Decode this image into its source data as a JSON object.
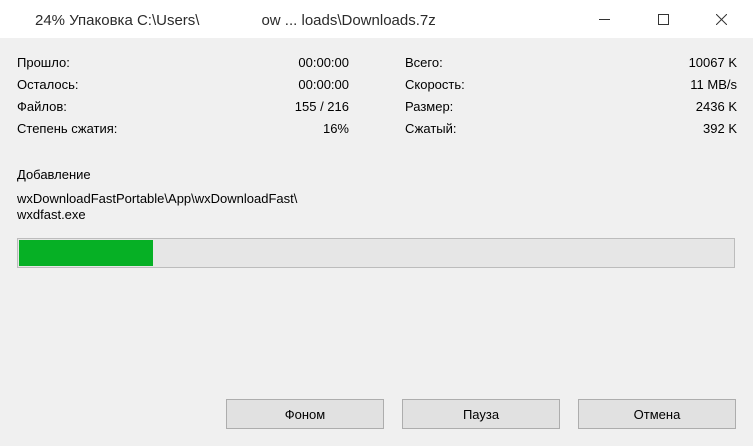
{
  "window": {
    "title_left": "24% Упаковка C:\\Users\\",
    "title_right": "ow ... loads\\Downloads.7z"
  },
  "stats": {
    "elapsed_label": "Прошло:",
    "elapsed_value": "00:00:00",
    "remaining_label": "Осталось:",
    "remaining_value": "00:00:00",
    "files_label": "Файлов:",
    "files_value": "155 / 216",
    "ratio_label": "Степень сжатия:",
    "ratio_value": "16%",
    "total_label": "Всего:",
    "total_value": "10067 K",
    "speed_label": "Скорость:",
    "speed_value": "11 MB/s",
    "size_label": "Размер:",
    "size_value": "2436 K",
    "compressed_label": "Сжатый:",
    "compressed_value": "392 K"
  },
  "current": {
    "action": "Добавление",
    "path_line1": "wxDownloadFastPortable\\App\\wxDownloadFast\\",
    "path_line2": "wxdfast.exe"
  },
  "progress": {
    "fraction": 0.188,
    "color": "#06b025"
  },
  "buttons": {
    "background": "Фоном",
    "pause": "Пауза",
    "cancel": "Отмена"
  },
  "icons": {
    "minimize": "minimize-icon",
    "maximize": "maximize-icon",
    "close": "close-icon"
  }
}
